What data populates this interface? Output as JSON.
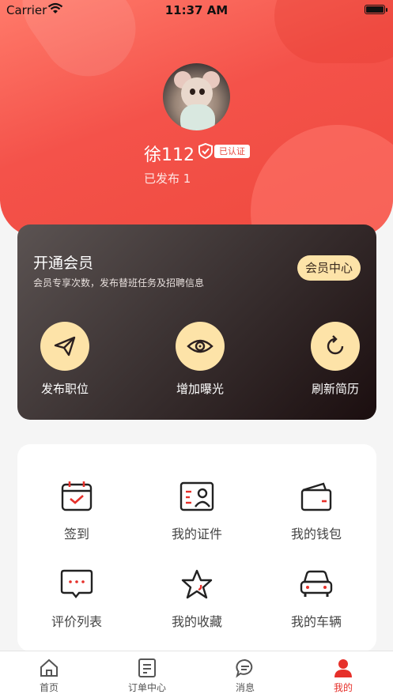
{
  "status_bar": {
    "carrier": "Carrier",
    "time": "11:37 AM"
  },
  "profile": {
    "username": "徐112",
    "verified_tag": "已认证",
    "posted": "已发布 1"
  },
  "member": {
    "title": "开通会员",
    "subtitle": "会员专享次数，发布替班任务及招聘信息",
    "center_button": "会员中心",
    "actions": [
      {
        "label": "发布职位",
        "icon": "paper-plane-icon"
      },
      {
        "label": "增加曝光",
        "icon": "eye-icon"
      },
      {
        "label": "刷新简历",
        "icon": "refresh-icon"
      }
    ]
  },
  "grid": {
    "items": [
      {
        "label": "签到",
        "icon": "calendar-check-icon"
      },
      {
        "label": "我的证件",
        "icon": "id-card-icon"
      },
      {
        "label": "我的钱包",
        "icon": "wallet-icon"
      },
      {
        "label": "评价列表",
        "icon": "comment-icon"
      },
      {
        "label": "我的收藏",
        "icon": "star-icon"
      },
      {
        "label": "我的车辆",
        "icon": "car-icon"
      }
    ]
  },
  "tabbar": {
    "tabs": [
      {
        "label": "首页",
        "icon": "home-icon"
      },
      {
        "label": "订单中心",
        "icon": "order-icon"
      },
      {
        "label": "消息",
        "icon": "message-icon"
      },
      {
        "label": "我的",
        "icon": "user-icon",
        "active": true
      }
    ]
  },
  "colors": {
    "accent": "#e6302a",
    "gold": "#fde3a8"
  }
}
